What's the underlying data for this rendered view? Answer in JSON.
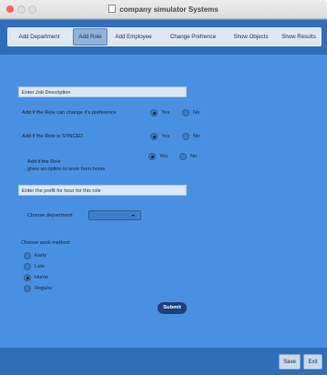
{
  "window": {
    "title": "company simulator Systems"
  },
  "tabs": [
    {
      "label": "Add Department"
    },
    {
      "label": "Add Role"
    },
    {
      "label": "Add Employee"
    },
    {
      "label": "Change Prefrence"
    },
    {
      "label": "Show Objects"
    },
    {
      "label": "Show Results"
    }
  ],
  "form": {
    "job_description_header": "Enter Job Description",
    "change_pref_label": "Add if the Role can change it's preference",
    "synced_label": "Add if the Role is SYNCED",
    "home_label_line1": "Add if the Role",
    "home_label_line2": "gives an option to work from home",
    "yes_label": "Yes",
    "no_label": "No",
    "profit_header": "Enter the profit for hour for this role",
    "department_label": "Choose department:",
    "department_selected": "",
    "work_method_label": "Choose work method:",
    "work_methods": [
      "Early",
      "Late",
      "Home",
      "Regular"
    ],
    "selected_work_method": "Home",
    "submit_label": "Submit"
  },
  "footer": {
    "save_label": "Save",
    "exit_label": "Exit"
  },
  "colors": {
    "panel": "#4a90e2",
    "bars": "#2f6fb9",
    "submit": "#1d3f7a"
  }
}
